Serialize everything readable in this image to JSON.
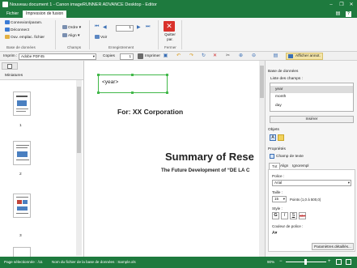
{
  "window": {
    "title": "Nouveau document 1 - Canon imageRUNNER ADVANCE Desktop - Editor",
    "min": "–",
    "max": "❐",
    "close": "✕"
  },
  "tabs": [
    {
      "label": "Fichier"
    },
    {
      "label": "Impression de fusion"
    }
  ],
  "ribbon": {
    "db_group": "Base de données",
    "connect": "Connexion/param.",
    "disconnect": "Déconnect",
    "open_file": "Ouv. emplac. fichier",
    "fields_group": "Champs",
    "order": "Ordre",
    "align": "Align",
    "record_group": "Enregistrement",
    "page_value": "1",
    "see": "Voir",
    "close_group": "Fermer",
    "close_label": "Quitter par."
  },
  "toolbar": {
    "printer_label": "Imprim :",
    "printer_value": "Adobe PDF45",
    "copies_label": "Copies",
    "copies_value": "1",
    "print": "Imprimer",
    "show_annot": "Afficher annot."
  },
  "left_panel": {
    "title": "Miniatures",
    "pages": [
      "1",
      "2",
      "3"
    ]
  },
  "canvas": {
    "field": "<year>",
    "for_line": "For: XX Corporation",
    "summary": "Summary of Rese",
    "subtitle": "The Future Development of “DE LA C"
  },
  "right_panel": {
    "db_title": "Base de données",
    "fields_label": "Liste des champs :",
    "fields": [
      "year",
      "month",
      "day"
    ],
    "insert": "Insérer",
    "objects_label": "Objets",
    "props_label": "Propriétés",
    "text_field": "Champ de texte",
    "prop_tabs": [
      "Txt",
      "Align",
      "Ignorempl"
    ],
    "font_label": "Police :",
    "font_value": "Arial",
    "size_label": "Taille :",
    "size_value": "15",
    "size_hint": "Points (1,0 à 500,0)",
    "style_label": "Style :",
    "color_label": "Couleur de police :",
    "details": "Paramètres détaillés..."
  },
  "status": {
    "page": "Page sélectionnée : /11",
    "db_file": "Nom du fichier de la base de données : Sample.xls",
    "zoom": "90%"
  }
}
